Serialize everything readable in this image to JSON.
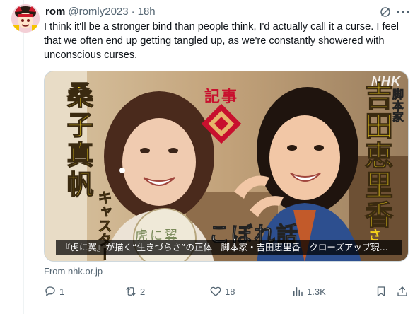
{
  "tweet": {
    "display_name": "rom",
    "handle": "@romly2023",
    "separator": "·",
    "time": "18h",
    "text": "I think it'll be a stronger bind than people think, I'd actually call it a curse. I feel that we often end up getting tangled up, as we're constantly showered with unconscious curses."
  },
  "media": {
    "caption": "『虎に翼』が描く“生きづらさ”の正体　脚本家・吉田恵里香 - クローズアップ現...",
    "logo": "NHK",
    "left_name": "桑子真帆",
    "left_role": "キャスター",
    "center_label": "記事",
    "right_role": "脚本家",
    "right_name": "吉田恵里香",
    "right_suffix": "さ",
    "bottom_title": "こぼれ話",
    "sign_text": "虎に翼"
  },
  "source": "From nhk.or.jp",
  "actions": {
    "reply_count": "1",
    "retweet_count": "2",
    "like_count": "18",
    "views_count": "1.3K"
  },
  "colors": {
    "text_primary": "#0f1419",
    "text_secondary": "#536471",
    "name_yellow": "#f5d21a",
    "label_red": "#c8102e"
  }
}
